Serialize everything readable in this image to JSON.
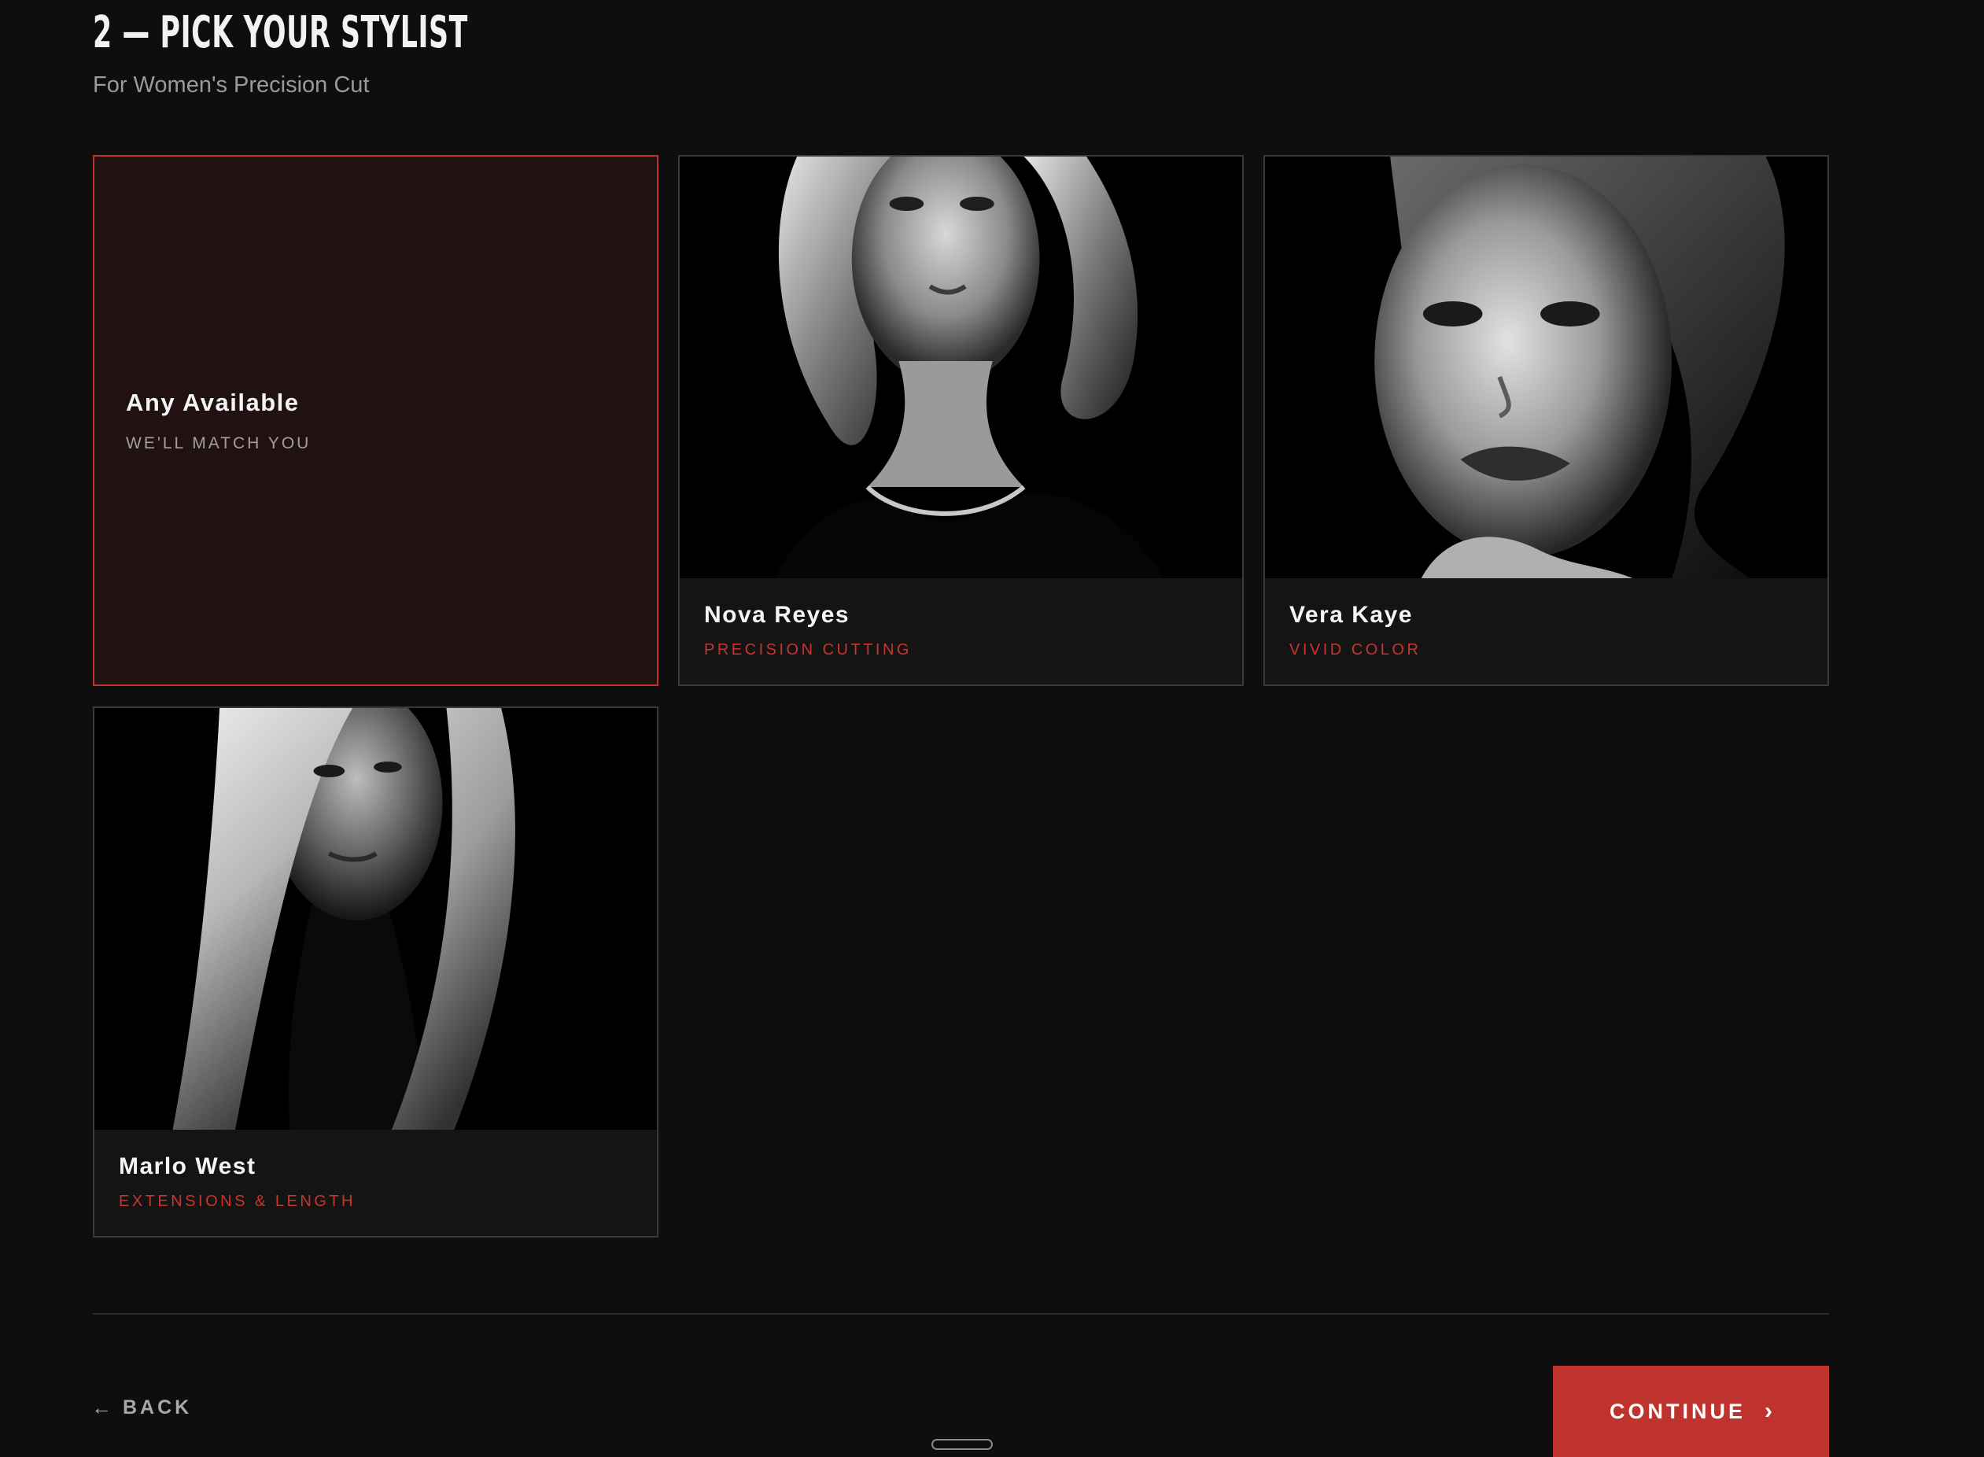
{
  "step": {
    "title": "2 — PICK YOUR STYLIST",
    "subtitle": "For Women's Precision Cut"
  },
  "any_option": {
    "name": "Any Available",
    "subtitle": "WE'LL MATCH YOU",
    "selected": true
  },
  "stylists": [
    {
      "name": "Nova Reyes",
      "specialty": "PRECISION CUTTING"
    },
    {
      "name": "Vera Kaye",
      "specialty": "VIVID COLOR"
    },
    {
      "name": "Marlo West",
      "specialty": "EXTENSIONS & LENGTH"
    }
  ],
  "navigation": {
    "back_label": "BACK",
    "back_icon": "arrow-left-icon",
    "continue_label": "CONTINUE",
    "continue_icon": "chevron-right-icon"
  },
  "colors": {
    "accent": "#c0322d",
    "background": "#0e0e0e",
    "selected_card_bg": "#211112"
  }
}
